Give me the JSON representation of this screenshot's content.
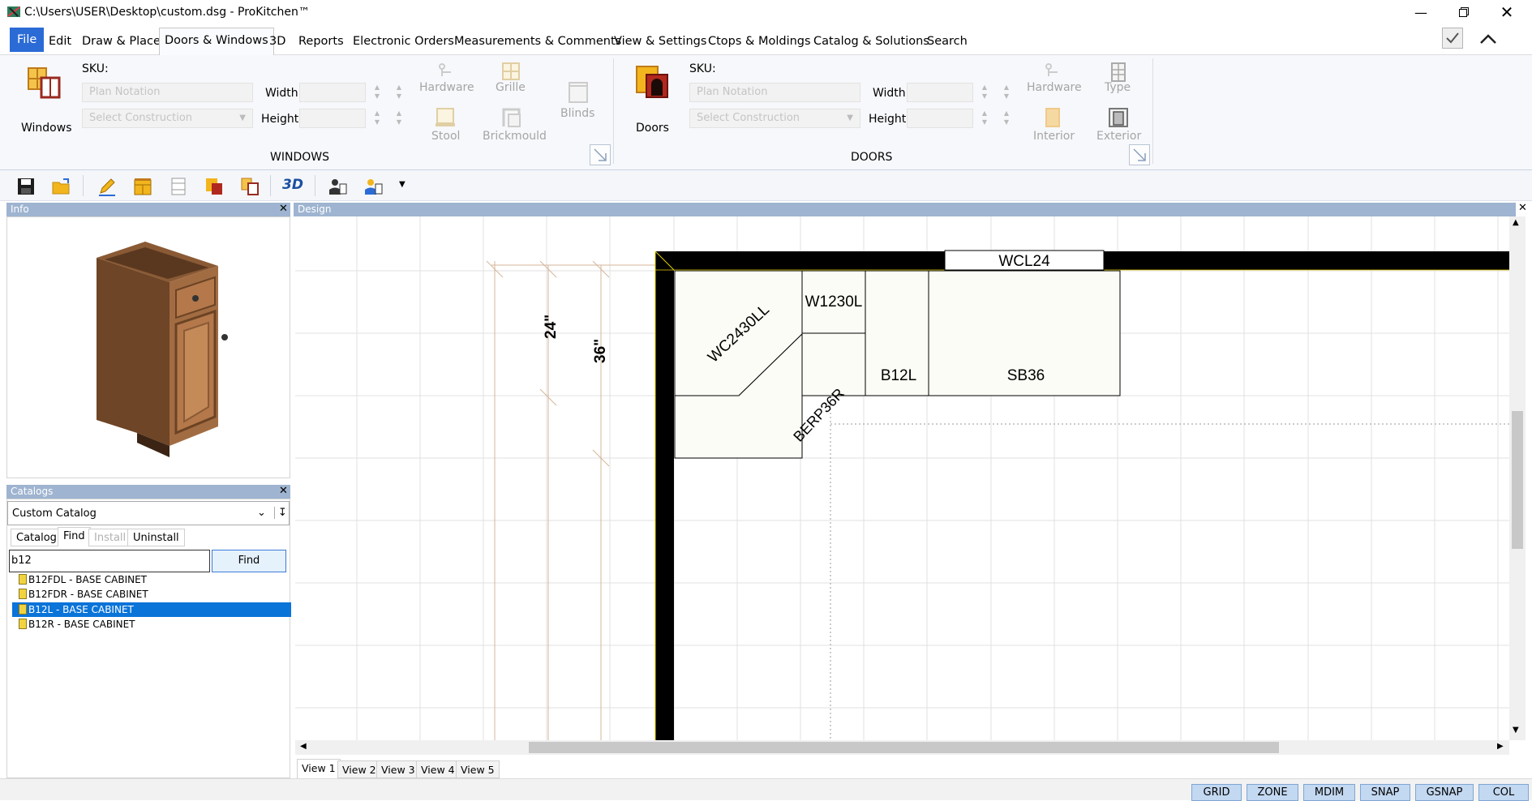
{
  "window": {
    "title": "C:\\Users\\USER\\Desktop\\custom.dsg - ProKitchen™"
  },
  "menu": {
    "file": "File",
    "items": [
      "Edit",
      "Draw & Place",
      "Doors & Windows",
      "3D",
      "Reports",
      "Electronic Orders",
      "Measurements & Comments",
      "View & Settings",
      "Ctops & Moldings",
      "Catalog & Solutions",
      "Search"
    ]
  },
  "ribbon": {
    "windows": {
      "big_button": "Windows",
      "sku_label": "SKU:",
      "plan_notation_placeholder": "Plan Notation",
      "construction_placeholder": "Select Construction",
      "width_label": "Width",
      "height_label": "Height",
      "hardware": "Hardware",
      "grille": "Grille",
      "blinds": "Blinds",
      "stool": "Stool",
      "brickmould": "Brickmould",
      "group": "WINDOWS"
    },
    "doors": {
      "big_button": "Doors",
      "sku_label": "SKU:",
      "plan_notation_placeholder": "Plan Notation",
      "construction_placeholder": "Select Construction",
      "width_label": "Width",
      "height_label": "Height",
      "hardware": "Hardware",
      "type": "Type",
      "interior": "Interior",
      "exterior": "Exterior",
      "group": "DOORS"
    }
  },
  "toolbar": {
    "three_d": "3D"
  },
  "info_panel": {
    "title": "Info"
  },
  "catalogs_panel": {
    "title": "Catalogs",
    "selected_catalog": "Custom Catalog",
    "tabs": [
      "Catalog",
      "Find",
      "Install",
      "Uninstall"
    ],
    "search_value": "b12",
    "find_button": "Find",
    "results": [
      {
        "label": "B12FDL - BASE CABINET",
        "selected": false
      },
      {
        "label": "B12FDR - BASE CABINET",
        "selected": false
      },
      {
        "label": "B12L - BASE CABINET",
        "selected": true
      },
      {
        "label": "B12R - BASE CABINET",
        "selected": false
      }
    ]
  },
  "design": {
    "title": "Design",
    "labels": {
      "wcl24": "WCL24",
      "wc2430ll": "WC2430LL",
      "w1230l": "W1230L",
      "b12l": "B12L",
      "sb36": "SB36",
      "berp36r": "BERP36R",
      "dim24": "24\"",
      "dim36": "36\""
    },
    "view_tabs": [
      "View 1",
      "View 2",
      "View 3",
      "View 4",
      "View 5"
    ]
  },
  "status": {
    "buttons": [
      "GRID",
      "ZONE",
      "MDIM",
      "SNAP",
      "GSNAP",
      "COL"
    ]
  },
  "colors": {
    "accent": "#2b6bd6",
    "selection": "#0a74d9",
    "panel_header": "#9eb4d0",
    "wall": "#000000",
    "cabinet_fill": "#fcfcf6"
  }
}
